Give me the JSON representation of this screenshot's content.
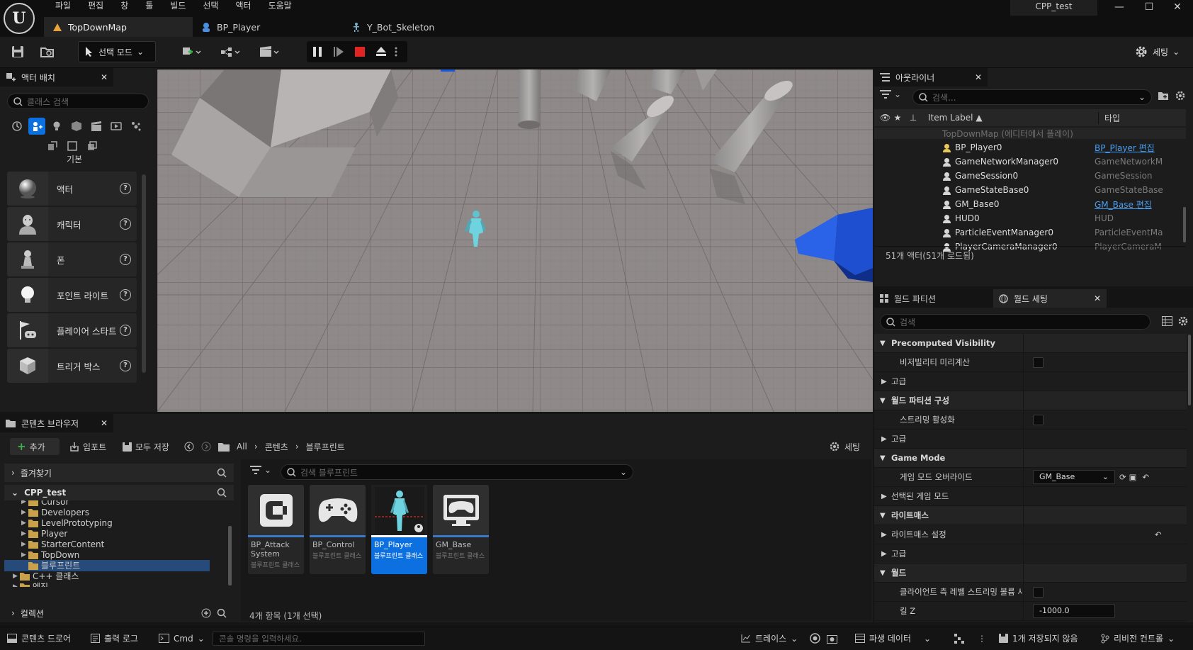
{
  "menu": [
    "파일",
    "편집",
    "창",
    "툴",
    "빌드",
    "선택",
    "액터",
    "도움말"
  ],
  "project_name": "CPP_test",
  "window_controls": {
    "minimize": "—",
    "maximize": "☐",
    "close": "✕"
  },
  "tabs": [
    {
      "label": "TopDownMap",
      "icon": "level-icon"
    },
    {
      "label": "BP_Player",
      "icon": "blueprint-icon"
    },
    {
      "label": "Y_Bot_Skeleton",
      "icon": "skeleton-icon"
    }
  ],
  "toolbar": {
    "mode_label": "선택 모드",
    "settings_label": "세팅"
  },
  "place_actors": {
    "title": "액터 배치",
    "search_placeholder": "클래스 검색",
    "category_label": "기본",
    "items": [
      {
        "label": "액터",
        "icon": "sphere-icon"
      },
      {
        "label": "캐릭터",
        "icon": "character-icon"
      },
      {
        "label": "폰",
        "icon": "pawn-icon"
      },
      {
        "label": "포인트 라이트",
        "icon": "light-bulb-icon"
      },
      {
        "label": "플레이어 스타트",
        "icon": "player-start-icon"
      },
      {
        "label": "트리거 박스",
        "icon": "cube-icon"
      }
    ]
  },
  "outliner": {
    "title": "아웃라이너",
    "search_placeholder": "검색...",
    "col_label": "Item Label ▲",
    "col_type": "타입",
    "root": "TopDownMap (에디터에서 플레이)",
    "rows": [
      {
        "label": "BP_Player0",
        "type": "BP_Player 편집",
        "link": true
      },
      {
        "label": "GameNetworkManager0",
        "type": "GameNetworkM",
        "link": false
      },
      {
        "label": "GameSession0",
        "type": "GameSession",
        "link": false
      },
      {
        "label": "GameStateBase0",
        "type": "GameStateBase",
        "link": false
      },
      {
        "label": "GM_Base0",
        "type": "GM_Base 편집",
        "link": true
      },
      {
        "label": "HUD0",
        "type": "HUD",
        "link": false
      },
      {
        "label": "ParticleEventManager0",
        "type": "ParticleEventMa",
        "link": false
      },
      {
        "label": "PlayerCameraManager0",
        "type": "PlayerCameraM",
        "link": false
      }
    ],
    "footer": "51개 액터(51개 로드됨)"
  },
  "details": {
    "tab_partition": "월드 파티션",
    "tab_settings": "월드 세팅",
    "search_placeholder": "검색",
    "rows": [
      {
        "kind": "section",
        "label": "Precomputed Visibility"
      },
      {
        "kind": "prop",
        "label": "비저빌리티 미리계산",
        "control": "checkbox"
      },
      {
        "kind": "sub",
        "label": "고급"
      },
      {
        "kind": "section",
        "label": "월드 파티션 구성"
      },
      {
        "kind": "prop",
        "label": "스트리밍 활성화",
        "control": "checkbox"
      },
      {
        "kind": "sub",
        "label": "고급"
      },
      {
        "kind": "section",
        "label": "Game Mode"
      },
      {
        "kind": "prop",
        "label": "게임 모드 오버라이드",
        "control": "dropdown",
        "value": "GM_Base"
      },
      {
        "kind": "sub",
        "label": "선택된 게임 모드"
      },
      {
        "kind": "section",
        "label": "라이트매스"
      },
      {
        "kind": "sub",
        "label": "라이트매스 설정",
        "control": "reset"
      },
      {
        "kind": "sub",
        "label": "고급"
      },
      {
        "kind": "section",
        "label": "월드"
      },
      {
        "kind": "prop",
        "label": "클라이언트 측 레벨 스트리밍 볼륨 사용",
        "control": "checkbox"
      },
      {
        "kind": "prop",
        "label": "킬 Z",
        "control": "number",
        "value": "-1000.0"
      }
    ]
  },
  "content_browser": {
    "title": "콘텐츠 브라우저",
    "add_label": "추가",
    "import_label": "임포트",
    "saveall_label": "모두 저장",
    "breadcrumb": [
      "All",
      "콘텐츠",
      "블루프린트"
    ],
    "settings_label": "세팅",
    "favorites_label": "즐겨찾기",
    "project_label": "CPP_test",
    "tree": [
      {
        "label": "Cursor",
        "depth": 2
      },
      {
        "label": "Developers",
        "depth": 2
      },
      {
        "label": "LevelPrototyping",
        "depth": 2
      },
      {
        "label": "Player",
        "depth": 2
      },
      {
        "label": "StarterContent",
        "depth": 2
      },
      {
        "label": "TopDown",
        "depth": 2
      },
      {
        "label": "블루프린트",
        "depth": 2,
        "selected": true
      },
      {
        "label": "C++ 클래스",
        "depth": 1
      },
      {
        "label": "엔진",
        "depth": 1
      }
    ],
    "collections_label": "컬렉션",
    "search_placeholder": "검색 블루프린트",
    "assets": [
      {
        "name": "BP_Attack System",
        "type": "블루프린트 클래스",
        "selected": false
      },
      {
        "name": "BP_Control",
        "type": "블루프린트 클래스",
        "selected": false
      },
      {
        "name": "BP_Player",
        "type": "블루프린트 클래스",
        "selected": true
      },
      {
        "name": "GM_Base",
        "type": "블루프린트 클래스",
        "selected": false
      }
    ],
    "count_label": "4개 항목 (1개 선택)"
  },
  "statusbar": {
    "drawer": "콘텐츠 드로어",
    "output": "출력 로그",
    "cmd": "Cmd",
    "console_placeholder": "콘솔 명령을 입력하세요.",
    "trace": "트레이스",
    "derived": "파생 데이터",
    "unsaved": "1개 저장되지 않음",
    "revision": "리비전 컨트롤"
  }
}
